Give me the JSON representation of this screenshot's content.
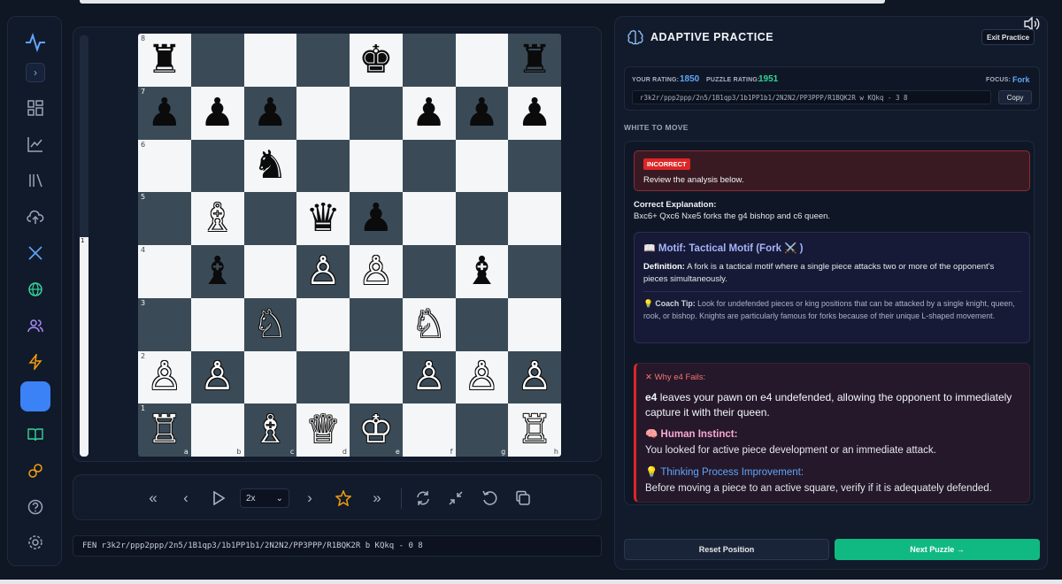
{
  "board": {
    "ranks": [
      "8",
      "7",
      "6",
      "5",
      "4",
      "3",
      "2",
      "1"
    ],
    "files": [
      "a",
      "b",
      "c",
      "d",
      "e",
      "f",
      "g",
      "h"
    ],
    "eval_label": "1",
    "squares": [
      [
        "♜",
        "",
        "",
        "",
        "♚",
        "",
        "",
        "♜"
      ],
      [
        "♟",
        "♟",
        "♟",
        "",
        "",
        "♟",
        "♟",
        "♟"
      ],
      [
        "",
        "",
        "♞",
        "",
        "",
        "",
        "",
        ""
      ],
      [
        "",
        "♗",
        "",
        "♛",
        "♟",
        "",
        "",
        ""
      ],
      [
        "",
        "♝",
        "",
        "♙",
        "♙",
        "",
        "♝",
        ""
      ],
      [
        "",
        "",
        "♘",
        "",
        "",
        "♘",
        "",
        ""
      ],
      [
        "♙",
        "♙",
        "",
        "",
        "",
        "♙",
        "♙",
        "♙"
      ],
      [
        "♖",
        "",
        "♗",
        "♕",
        "♔",
        "",
        "",
        "♖"
      ]
    ],
    "piece_colors": [
      [
        "b",
        "",
        "",
        "",
        "b",
        "",
        "",
        "b"
      ],
      [
        "b",
        "b",
        "b",
        "",
        "",
        "b",
        "b",
        "b"
      ],
      [
        "",
        "",
        "b",
        "",
        "",
        "",
        "",
        ""
      ],
      [
        "",
        "w",
        "",
        "b",
        "b",
        "",
        "",
        ""
      ],
      [
        "",
        "b",
        "",
        "w",
        "w",
        "",
        "b",
        ""
      ],
      [
        "",
        "",
        "w",
        "",
        "",
        "w",
        "",
        ""
      ],
      [
        "w",
        "w",
        "",
        "",
        "",
        "w",
        "w",
        "w"
      ],
      [
        "w",
        "",
        "w",
        "w",
        "w",
        "",
        "",
        "w"
      ]
    ]
  },
  "controls": {
    "speed": "2x",
    "speed_arrow": "⌄"
  },
  "fen_bar": "FEN  r3k2r/ppp2ppp/2n5/1B1qp3/1b1PP1b1/2N2N2/PP3PPP/R1BQK2R b KQkq - 0 8",
  "practice": {
    "title": "ADAPTIVE PRACTICE",
    "exit_label": "Exit Practice",
    "your_rating_label": "YOUR RATING:",
    "your_rating": "1850",
    "puzzle_rating_label": "PUZZLE RATING:",
    "puzzle_rating": "1951",
    "focus_label": "FOCUS:",
    "focus": "Fork",
    "fen": "r3k2r/ppp2ppp/2n5/1B1qp3/1b1PP1b1/2N2N2/PP3PPP/R1BQK2R w KQkq - 3 8",
    "copy_label": "Copy",
    "to_move": "WHITE TO MOVE"
  },
  "analysis": {
    "badge": "INCORRECT",
    "review_text": "Review the analysis below.",
    "correct_title": "Correct Explanation:",
    "correct_text": "Bxc6+ Qxc6 Nxe5 forks the g4 bishop and c6 queen.",
    "motif_title": "Motif: Tactical Motif (Fork ⚔️ )",
    "definition_label": "Definition:",
    "definition_text": " A fork is a tactical motif where a single piece attacks two or more of the opponent's pieces simultaneously.",
    "coach_label": "Coach Tip:",
    "coach_text": " Look for undefended pieces or king positions that can be attacked by a single knight, queen, rook, or bishop. Knights are particularly famous for forks because of their unique L-shaped movement.",
    "fail_title": "Why e4 Fails:",
    "fail_move": "e4",
    "fail_text": " leaves your pawn on e4 undefended, allowing the opponent to immediately capture it with their queen.",
    "instinct_title": "Human Instinct:",
    "instinct_text": "You looked for active piece development or an immediate attack.",
    "thinking_title": "Thinking Process Improvement:",
    "thinking_text": "Before moving a piece to an active square, verify if it is adequately defended."
  },
  "buttons": {
    "reset": "Reset Position",
    "next": "Next Puzzle →"
  },
  "colors": {
    "accent_blue": "#3b82f6",
    "success_green": "#10b981",
    "error_red": "#dc2626",
    "light_square": "#f5f6f7",
    "dark_square": "#3a4b57"
  },
  "eval": {
    "white_fraction": 0.52
  }
}
